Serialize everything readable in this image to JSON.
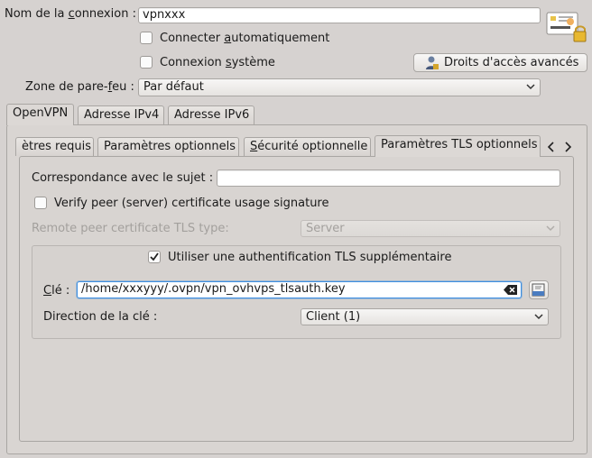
{
  "connection": {
    "name_label_pre": "Nom de la ",
    "name_label_u": "c",
    "name_label_post": "onnexion :",
    "name_value": "vpnxxx",
    "auto_connect_pre": "Connecter ",
    "auto_connect_u": "a",
    "auto_connect_post": "utomatiquement",
    "system_pre": "Connexion ",
    "system_u": "s",
    "system_post": "ystème",
    "access_button": "Droits d'accès avancés",
    "firewall_label_pre": "Zone de pare-",
    "firewall_label_u": "f",
    "firewall_label_post": "eu :",
    "firewall_value": "Par défaut"
  },
  "main_tabs": [
    {
      "label": "OpenVPN"
    },
    {
      "label": "Adresse IPv4"
    },
    {
      "label": "Adresse IPv6"
    }
  ],
  "sub_tabs": [
    {
      "label": "ètres requis"
    },
    {
      "label": "Paramètres optionnels"
    },
    {
      "label_u": "S",
      "label_rest": "écurité optionnelle"
    },
    {
      "label": "Paramètres TLS optionnels"
    }
  ],
  "tls": {
    "subject_label": "Correspondance avec le sujet :",
    "subject_value": "",
    "verify_label": "Verify peer (server) certificate usage signature",
    "remote_type_label": "Remote peer certificate TLS type:",
    "remote_type_value": "Server",
    "extra_auth_label": "Utiliser une authentification TLS supplémentaire",
    "key_label_u": "C",
    "key_label_rest": "lé :",
    "key_value": "/home/xxxyyy/.ovpn/vpn_ovhvps_tlsauth.key",
    "direction_label": "Direction de la clé :",
    "direction_value": "Client (1)"
  },
  "colors": {
    "background": "#d6d2d0",
    "input_focus": "#3d8ee0",
    "check_mark": "#222222"
  }
}
